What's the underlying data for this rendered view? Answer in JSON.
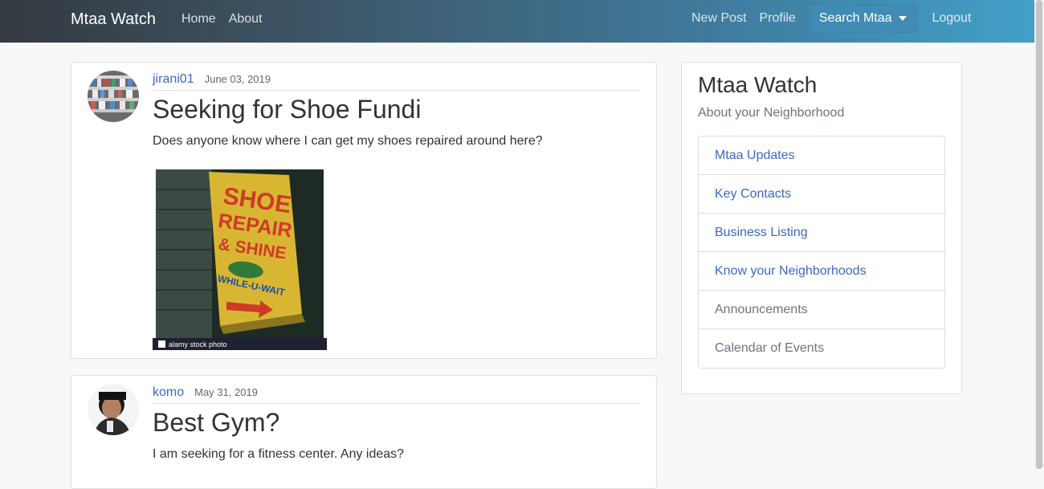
{
  "navbar": {
    "brand": "Mtaa Watch",
    "left_links": [
      "Home",
      "About"
    ],
    "right_links": {
      "new_post": "New Post",
      "profile": "Profile",
      "search": "Search Mtaa",
      "logout": "Logout"
    }
  },
  "posts": [
    {
      "author": "jirani01",
      "date": "June 03, 2019",
      "title": "Seeking for Shoe Fundi",
      "body": "Does anyone know where I can get my shoes repaired around here?",
      "image": {
        "sign_text": [
          "SHOE",
          "REPAIR",
          "& SHINE",
          "WHILE-U-WAIT"
        ],
        "caption": "alamy stock photo"
      }
    },
    {
      "author": "komo",
      "date": "May 31, 2019",
      "title": "Best Gym?",
      "body": "I am seeking for a fitness center. Any ideas?"
    }
  ],
  "sidebar": {
    "title": "Mtaa Watch",
    "subtitle": "About your Neighborhood",
    "items": [
      {
        "label": "Mtaa Updates"
      },
      {
        "label": "Key Contacts"
      },
      {
        "label": "Business Listing"
      },
      {
        "label": "Know your Neighborhoods"
      },
      {
        "label": "Announcements"
      },
      {
        "label": "Calendar of Events"
      }
    ]
  }
}
